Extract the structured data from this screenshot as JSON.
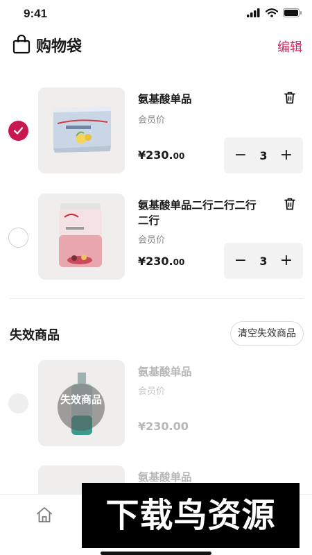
{
  "status_bar": {
    "time": "9:41"
  },
  "header": {
    "title": "购物袋",
    "edit_label": "编辑"
  },
  "cart_items": [
    {
      "name": "氨基酸单品",
      "price_label": "会员价",
      "price_main": "¥230.",
      "price_decimal": "00",
      "quantity": "3",
      "selected": true
    },
    {
      "name": "氨基酸单品二行二行二行二行",
      "price_label": "会员价",
      "price_main": "¥230.",
      "price_decimal": "00",
      "quantity": "3",
      "selected": false
    }
  ],
  "invalid_section": {
    "title": "失效商品",
    "clear_label": "清空失效商品",
    "items": [
      {
        "name": "氨基酸单品",
        "price_label": "会员价",
        "price": "¥230.00",
        "overlay_label": "失效商品"
      },
      {
        "name": "氨基酸单品"
      }
    ]
  },
  "banner": {
    "text": "下载鸟资源"
  },
  "colors": {
    "accent": "#c8194f",
    "edit": "#d6245c"
  },
  "icons": [
    "shopping-bag-icon",
    "trash-icon",
    "home-icon",
    "signal-icon",
    "wifi-icon",
    "battery-icon",
    "checkmark-icon"
  ]
}
